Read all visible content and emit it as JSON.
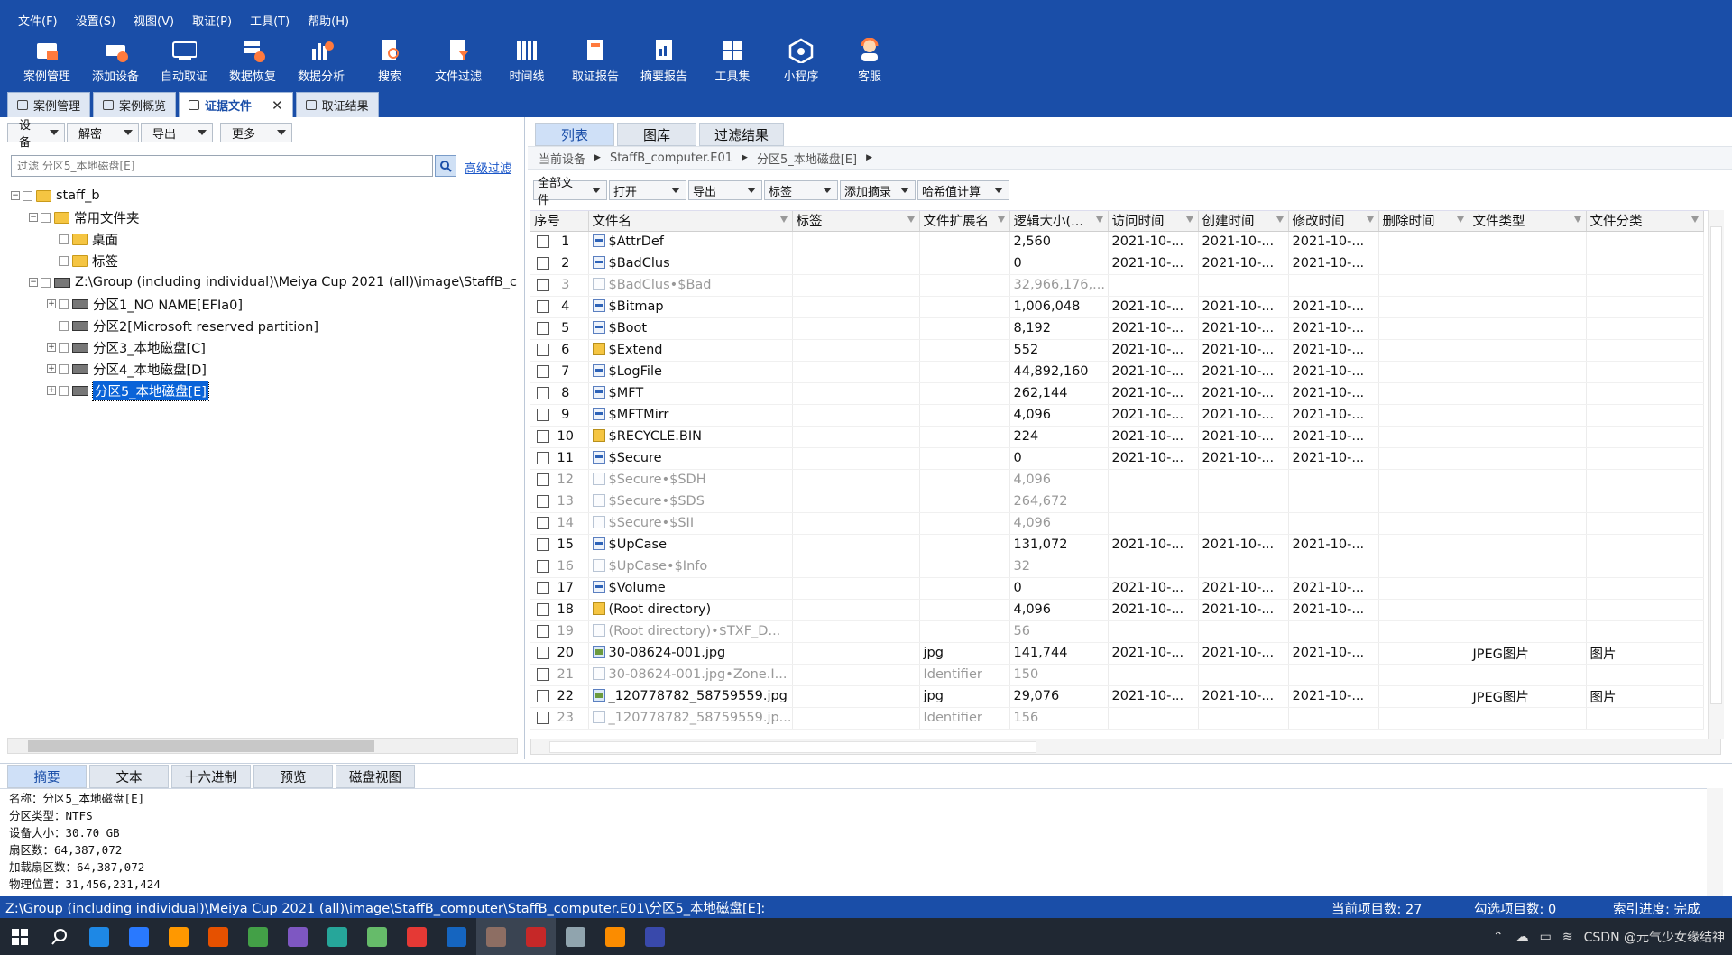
{
  "menu": [
    "文件(F)",
    "设置(S)",
    "视图(V)",
    "取证(P)",
    "工具(T)",
    "帮助(H)"
  ],
  "toolbar": [
    {
      "label": "案例管理",
      "icon": "case-folder-icon",
      "color": "#ff7a3d"
    },
    {
      "label": "添加设备",
      "icon": "add-device-icon",
      "color": "#ffffff"
    },
    {
      "label": "自动取证",
      "icon": "auto-icon",
      "color": "#ffffff"
    },
    {
      "label": "数据恢复",
      "icon": "recover-icon",
      "color": "#ffffff"
    },
    {
      "label": "数据分析",
      "icon": "analysis-icon",
      "color": "#ffffff"
    },
    {
      "label": "搜索",
      "icon": "search-doc-icon",
      "color": "#ffffff"
    },
    {
      "label": "文件过滤",
      "icon": "filter-doc-icon",
      "color": "#ffffff"
    },
    {
      "label": "时间线",
      "icon": "timeline-icon",
      "color": "#ffffff"
    },
    {
      "label": "取证报告",
      "icon": "report-icon",
      "color": "#ffffff"
    },
    {
      "label": "摘要报告",
      "icon": "summary-report-icon",
      "color": "#ffffff"
    },
    {
      "label": "工具集",
      "icon": "toolset-icon",
      "color": "#ffffff"
    },
    {
      "label": "小程序",
      "icon": "miniprogram-icon",
      "color": "#ffffff"
    },
    {
      "label": "客服",
      "icon": "support-icon",
      "color": "#ff7a3d"
    }
  ],
  "main_tabs": [
    {
      "label": "案例管理"
    },
    {
      "label": "案例概览"
    },
    {
      "label": "证据文件",
      "close": "✕"
    },
    {
      "label": "取证结果"
    }
  ],
  "left": {
    "dropdowns": [
      "设备",
      "解密",
      "导出",
      "更多"
    ],
    "filter_placeholder": "过滤 分区5_本地磁盘[E]",
    "advanced_filter": "高级过滤",
    "tree": [
      {
        "label": "staff_b"
      },
      {
        "label": "常用文件夹"
      },
      {
        "label": "桌面"
      },
      {
        "label": "标签"
      },
      {
        "label": "Z:\\Group (including individual)\\Meiya Cup 2021 (all)\\image\\StaffB_c"
      },
      {
        "label": "分区1_NO NAME[EFIa0]"
      },
      {
        "label": "分区2[Microsoft reserved partition]"
      },
      {
        "label": "分区3_本地磁盘[C]"
      },
      {
        "label": "分区4_本地磁盘[D]"
      },
      {
        "label": "分区5_本地磁盘[E]"
      }
    ]
  },
  "right": {
    "tabs": [
      "列表",
      "图库",
      "过滤结果"
    ],
    "breadcrumb": [
      "当前设备",
      "StaffB_computer.E01",
      "分区5_本地磁盘[E]"
    ],
    "tools": [
      "全部文件",
      "打开",
      "导出",
      "标签",
      "添加摘录",
      "哈希值计算"
    ],
    "columns": [
      "序号",
      "文件名",
      "标签",
      "文件扩展名",
      "逻辑大小(...",
      "访问时间",
      "创建时间",
      "修改时间",
      "删除时间",
      "文件类型",
      "文件分类"
    ],
    "rows": [
      {
        "n": "1",
        "icon": "sys",
        "name": "$AttrDef",
        "ext": "",
        "size": "2,560",
        "a": "2021-10-...",
        "c": "2021-10-...",
        "m": "2021-10-...",
        "type": "",
        "cat": "",
        "dim": false
      },
      {
        "n": "2",
        "icon": "sys",
        "name": "$BadClus",
        "ext": "",
        "size": "0",
        "a": "2021-10-...",
        "c": "2021-10-...",
        "m": "2021-10-...",
        "type": "",
        "cat": "",
        "dim": false
      },
      {
        "n": "3",
        "icon": "blank",
        "name": "$BadClus•$Bad",
        "ext": "",
        "size": "32,966,176,...",
        "a": "",
        "c": "",
        "m": "",
        "type": "",
        "cat": "",
        "dim": true
      },
      {
        "n": "4",
        "icon": "sys",
        "name": "$Bitmap",
        "ext": "",
        "size": "1,006,048",
        "a": "2021-10-...",
        "c": "2021-10-...",
        "m": "2021-10-...",
        "type": "",
        "cat": "",
        "dim": false
      },
      {
        "n": "5",
        "icon": "sys",
        "name": "$Boot",
        "ext": "",
        "size": "8,192",
        "a": "2021-10-...",
        "c": "2021-10-...",
        "m": "2021-10-...",
        "type": "",
        "cat": "",
        "dim": false
      },
      {
        "n": "6",
        "icon": "fold",
        "name": "$Extend",
        "ext": "",
        "size": "552",
        "a": "2021-10-...",
        "c": "2021-10-...",
        "m": "2021-10-...",
        "type": "",
        "cat": "",
        "dim": false
      },
      {
        "n": "7",
        "icon": "sys",
        "name": "$LogFile",
        "ext": "",
        "size": "44,892,160",
        "a": "2021-10-...",
        "c": "2021-10-...",
        "m": "2021-10-...",
        "type": "",
        "cat": "",
        "dim": false
      },
      {
        "n": "8",
        "icon": "sys",
        "name": "$MFT",
        "ext": "",
        "size": "262,144",
        "a": "2021-10-...",
        "c": "2021-10-...",
        "m": "2021-10-...",
        "type": "",
        "cat": "",
        "dim": false
      },
      {
        "n": "9",
        "icon": "sys",
        "name": "$MFTMirr",
        "ext": "",
        "size": "4,096",
        "a": "2021-10-...",
        "c": "2021-10-...",
        "m": "2021-10-...",
        "type": "",
        "cat": "",
        "dim": false
      },
      {
        "n": "10",
        "icon": "fold",
        "name": "$RECYCLE.BIN",
        "ext": "",
        "size": "224",
        "a": "2021-10-...",
        "c": "2021-10-...",
        "m": "2021-10-...",
        "type": "",
        "cat": "",
        "dim": false
      },
      {
        "n": "11",
        "icon": "sys",
        "name": "$Secure",
        "ext": "",
        "size": "0",
        "a": "2021-10-...",
        "c": "2021-10-...",
        "m": "2021-10-...",
        "type": "",
        "cat": "",
        "dim": false
      },
      {
        "n": "12",
        "icon": "blank",
        "name": "$Secure•$SDH",
        "ext": "",
        "size": "4,096",
        "a": "",
        "c": "",
        "m": "",
        "type": "",
        "cat": "",
        "dim": true
      },
      {
        "n": "13",
        "icon": "blank",
        "name": "$Secure•$SDS",
        "ext": "",
        "size": "264,672",
        "a": "",
        "c": "",
        "m": "",
        "type": "",
        "cat": "",
        "dim": true
      },
      {
        "n": "14",
        "icon": "blank",
        "name": "$Secure•$SII",
        "ext": "",
        "size": "4,096",
        "a": "",
        "c": "",
        "m": "",
        "type": "",
        "cat": "",
        "dim": true
      },
      {
        "n": "15",
        "icon": "sys",
        "name": "$UpCase",
        "ext": "",
        "size": "131,072",
        "a": "2021-10-...",
        "c": "2021-10-...",
        "m": "2021-10-...",
        "type": "",
        "cat": "",
        "dim": false
      },
      {
        "n": "16",
        "icon": "blank",
        "name": "$UpCase•$Info",
        "ext": "",
        "size": "32",
        "a": "",
        "c": "",
        "m": "",
        "type": "",
        "cat": "",
        "dim": true
      },
      {
        "n": "17",
        "icon": "sys",
        "name": "$Volume",
        "ext": "",
        "size": "0",
        "a": "2021-10-...",
        "c": "2021-10-...",
        "m": "2021-10-...",
        "type": "",
        "cat": "",
        "dim": false
      },
      {
        "n": "18",
        "icon": "fold",
        "name": "(Root directory)",
        "ext": "",
        "size": "4,096",
        "a": "2021-10-...",
        "c": "2021-10-...",
        "m": "2021-10-...",
        "type": "",
        "cat": "",
        "dim": false
      },
      {
        "n": "19",
        "icon": "blank",
        "name": "(Root directory)•$TXF_D...",
        "ext": "",
        "size": "56",
        "a": "",
        "c": "",
        "m": "",
        "type": "",
        "cat": "",
        "dim": true
      },
      {
        "n": "20",
        "icon": "img",
        "name": "30-08624-001.jpg",
        "ext": "jpg",
        "size": "141,744",
        "a": "2021-10-...",
        "c": "2021-10-...",
        "m": "2021-10-...",
        "type": "JPEG图片",
        "cat": "图片",
        "dim": false
      },
      {
        "n": "21",
        "icon": "blank",
        "name": "30-08624-001.jpg•Zone.I...",
        "ext": "Identifier",
        "size": "150",
        "a": "",
        "c": "",
        "m": "",
        "type": "",
        "cat": "",
        "dim": true
      },
      {
        "n": "22",
        "icon": "img",
        "name": "_120778782_58759559.jpg",
        "ext": "jpg",
        "size": "29,076",
        "a": "2021-10-...",
        "c": "2021-10-...",
        "m": "2021-10-...",
        "type": "JPEG图片",
        "cat": "图片",
        "dim": false
      },
      {
        "n": "23",
        "icon": "blank",
        "name": "_120778782_58759559.jp...",
        "ext": "Identifier",
        "size": "156",
        "a": "",
        "c": "",
        "m": "",
        "type": "",
        "cat": "",
        "dim": true
      }
    ]
  },
  "bottom": {
    "tabs": [
      "摘要",
      "文本",
      "十六进制",
      "预览",
      "磁盘视图"
    ],
    "summary": [
      "名称：分区5_本地磁盘[E]",
      "分区类型：NTFS",
      "设备大小：30.70 GB",
      "扇区数：64,387,072",
      "加载扇区数：64,387,072",
      "物理位置：31,456,231,424"
    ]
  },
  "status": {
    "path": "Z:\\Group (including individual)\\Meiya Cup 2021 (all)\\image\\StaffB_computer\\StaffB_computer.E01\\分区5_本地磁盘[E]:",
    "current_items": "当前项目数: 27",
    "checked_items": "勾选项目数: 0",
    "index_progress": "索引进度: 完成"
  },
  "taskbar": {
    "apps": [
      "#1e88e5",
      "#2979ff",
      "#ff9800",
      "#e65100",
      "#43a047",
      "#7e57c2",
      "#26a69a",
      "#66bb6a",
      "#e53935",
      "#1565c0",
      "#8d6e63",
      "#c62828",
      "#90a4ae",
      "#fb8c00",
      "#3949ab"
    ],
    "tray_text": "CSDN @元气少女缘结神"
  }
}
